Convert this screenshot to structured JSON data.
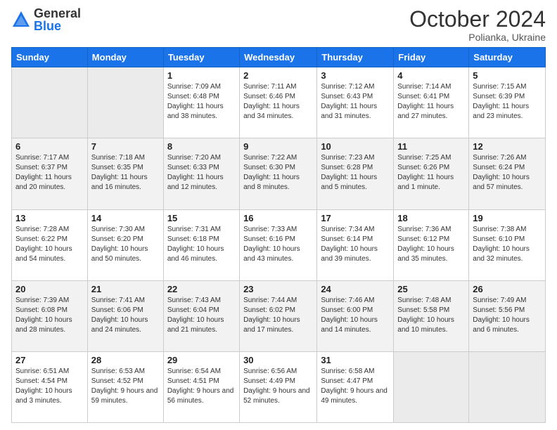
{
  "logo": {
    "general": "General",
    "blue": "Blue"
  },
  "title": "October 2024",
  "location": "Polianka, Ukraine",
  "days_of_week": [
    "Sunday",
    "Monday",
    "Tuesday",
    "Wednesday",
    "Thursday",
    "Friday",
    "Saturday"
  ],
  "weeks": [
    [
      {
        "date": "",
        "sunrise": "",
        "sunset": "",
        "daylight": ""
      },
      {
        "date": "",
        "sunrise": "",
        "sunset": "",
        "daylight": ""
      },
      {
        "date": "1",
        "sunrise": "Sunrise: 7:09 AM",
        "sunset": "Sunset: 6:48 PM",
        "daylight": "Daylight: 11 hours and 38 minutes."
      },
      {
        "date": "2",
        "sunrise": "Sunrise: 7:11 AM",
        "sunset": "Sunset: 6:46 PM",
        "daylight": "Daylight: 11 hours and 34 minutes."
      },
      {
        "date": "3",
        "sunrise": "Sunrise: 7:12 AM",
        "sunset": "Sunset: 6:43 PM",
        "daylight": "Daylight: 11 hours and 31 minutes."
      },
      {
        "date": "4",
        "sunrise": "Sunrise: 7:14 AM",
        "sunset": "Sunset: 6:41 PM",
        "daylight": "Daylight: 11 hours and 27 minutes."
      },
      {
        "date": "5",
        "sunrise": "Sunrise: 7:15 AM",
        "sunset": "Sunset: 6:39 PM",
        "daylight": "Daylight: 11 hours and 23 minutes."
      }
    ],
    [
      {
        "date": "6",
        "sunrise": "Sunrise: 7:17 AM",
        "sunset": "Sunset: 6:37 PM",
        "daylight": "Daylight: 11 hours and 20 minutes."
      },
      {
        "date": "7",
        "sunrise": "Sunrise: 7:18 AM",
        "sunset": "Sunset: 6:35 PM",
        "daylight": "Daylight: 11 hours and 16 minutes."
      },
      {
        "date": "8",
        "sunrise": "Sunrise: 7:20 AM",
        "sunset": "Sunset: 6:33 PM",
        "daylight": "Daylight: 11 hours and 12 minutes."
      },
      {
        "date": "9",
        "sunrise": "Sunrise: 7:22 AM",
        "sunset": "Sunset: 6:30 PM",
        "daylight": "Daylight: 11 hours and 8 minutes."
      },
      {
        "date": "10",
        "sunrise": "Sunrise: 7:23 AM",
        "sunset": "Sunset: 6:28 PM",
        "daylight": "Daylight: 11 hours and 5 minutes."
      },
      {
        "date": "11",
        "sunrise": "Sunrise: 7:25 AM",
        "sunset": "Sunset: 6:26 PM",
        "daylight": "Daylight: 11 hours and 1 minute."
      },
      {
        "date": "12",
        "sunrise": "Sunrise: 7:26 AM",
        "sunset": "Sunset: 6:24 PM",
        "daylight": "Daylight: 10 hours and 57 minutes."
      }
    ],
    [
      {
        "date": "13",
        "sunrise": "Sunrise: 7:28 AM",
        "sunset": "Sunset: 6:22 PM",
        "daylight": "Daylight: 10 hours and 54 minutes."
      },
      {
        "date": "14",
        "sunrise": "Sunrise: 7:30 AM",
        "sunset": "Sunset: 6:20 PM",
        "daylight": "Daylight: 10 hours and 50 minutes."
      },
      {
        "date": "15",
        "sunrise": "Sunrise: 7:31 AM",
        "sunset": "Sunset: 6:18 PM",
        "daylight": "Daylight: 10 hours and 46 minutes."
      },
      {
        "date": "16",
        "sunrise": "Sunrise: 7:33 AM",
        "sunset": "Sunset: 6:16 PM",
        "daylight": "Daylight: 10 hours and 43 minutes."
      },
      {
        "date": "17",
        "sunrise": "Sunrise: 7:34 AM",
        "sunset": "Sunset: 6:14 PM",
        "daylight": "Daylight: 10 hours and 39 minutes."
      },
      {
        "date": "18",
        "sunrise": "Sunrise: 7:36 AM",
        "sunset": "Sunset: 6:12 PM",
        "daylight": "Daylight: 10 hours and 35 minutes."
      },
      {
        "date": "19",
        "sunrise": "Sunrise: 7:38 AM",
        "sunset": "Sunset: 6:10 PM",
        "daylight": "Daylight: 10 hours and 32 minutes."
      }
    ],
    [
      {
        "date": "20",
        "sunrise": "Sunrise: 7:39 AM",
        "sunset": "Sunset: 6:08 PM",
        "daylight": "Daylight: 10 hours and 28 minutes."
      },
      {
        "date": "21",
        "sunrise": "Sunrise: 7:41 AM",
        "sunset": "Sunset: 6:06 PM",
        "daylight": "Daylight: 10 hours and 24 minutes."
      },
      {
        "date": "22",
        "sunrise": "Sunrise: 7:43 AM",
        "sunset": "Sunset: 6:04 PM",
        "daylight": "Daylight: 10 hours and 21 minutes."
      },
      {
        "date": "23",
        "sunrise": "Sunrise: 7:44 AM",
        "sunset": "Sunset: 6:02 PM",
        "daylight": "Daylight: 10 hours and 17 minutes."
      },
      {
        "date": "24",
        "sunrise": "Sunrise: 7:46 AM",
        "sunset": "Sunset: 6:00 PM",
        "daylight": "Daylight: 10 hours and 14 minutes."
      },
      {
        "date": "25",
        "sunrise": "Sunrise: 7:48 AM",
        "sunset": "Sunset: 5:58 PM",
        "daylight": "Daylight: 10 hours and 10 minutes."
      },
      {
        "date": "26",
        "sunrise": "Sunrise: 7:49 AM",
        "sunset": "Sunset: 5:56 PM",
        "daylight": "Daylight: 10 hours and 6 minutes."
      }
    ],
    [
      {
        "date": "27",
        "sunrise": "Sunrise: 6:51 AM",
        "sunset": "Sunset: 4:54 PM",
        "daylight": "Daylight: 10 hours and 3 minutes."
      },
      {
        "date": "28",
        "sunrise": "Sunrise: 6:53 AM",
        "sunset": "Sunset: 4:52 PM",
        "daylight": "Daylight: 9 hours and 59 minutes."
      },
      {
        "date": "29",
        "sunrise": "Sunrise: 6:54 AM",
        "sunset": "Sunset: 4:51 PM",
        "daylight": "Daylight: 9 hours and 56 minutes."
      },
      {
        "date": "30",
        "sunrise": "Sunrise: 6:56 AM",
        "sunset": "Sunset: 4:49 PM",
        "daylight": "Daylight: 9 hours and 52 minutes."
      },
      {
        "date": "31",
        "sunrise": "Sunrise: 6:58 AM",
        "sunset": "Sunset: 4:47 PM",
        "daylight": "Daylight: 9 hours and 49 minutes."
      },
      {
        "date": "",
        "sunrise": "",
        "sunset": "",
        "daylight": ""
      },
      {
        "date": "",
        "sunrise": "",
        "sunset": "",
        "daylight": ""
      }
    ]
  ]
}
